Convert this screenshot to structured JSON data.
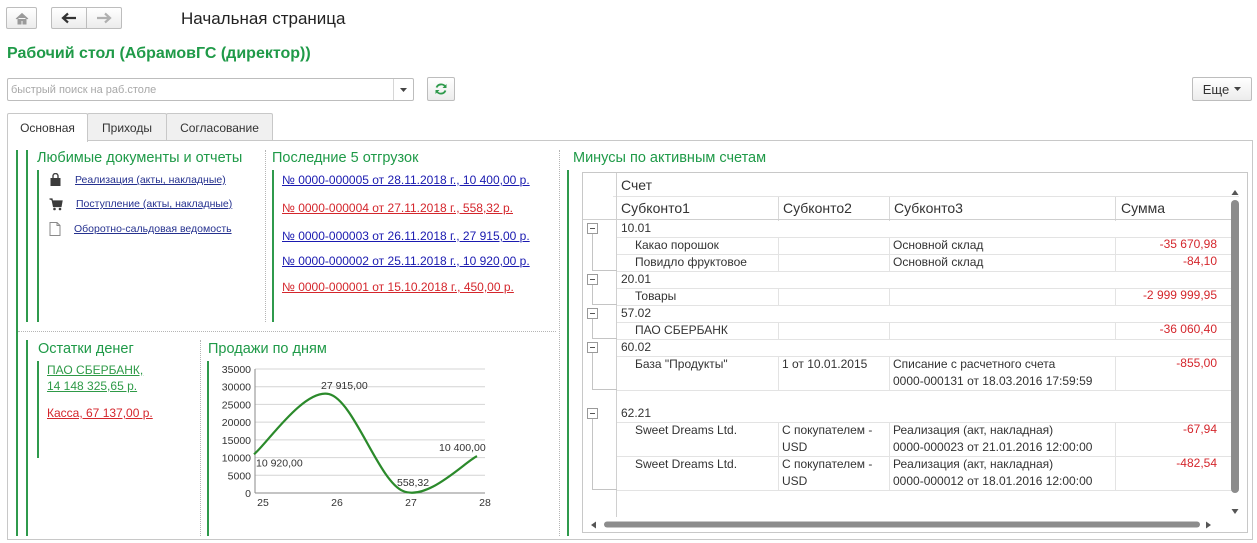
{
  "nav": {
    "title": "Начальная страница",
    "home_icon": "home-icon",
    "back_icon": "arrow-left-icon",
    "forward_icon": "arrow-right-icon"
  },
  "workspace": {
    "title": "Рабочий стол (АбрамовГС (директор))",
    "search_placeholder": "быстрый поиск на раб.столе",
    "more_label": "Еще"
  },
  "tabs": [
    "Основная",
    "Приходы",
    "Согласование"
  ],
  "favorites": {
    "title": "Любимые документы и отчеты",
    "items": [
      {
        "icon": "bag-icon",
        "label": "Реализация (акты, накладные)"
      },
      {
        "icon": "cart-icon",
        "label": "Поступление (акты, накладные)"
      },
      {
        "icon": "document-icon",
        "label": "Оборотно-сальдовая ведомость"
      }
    ]
  },
  "shipments": {
    "title": "Последние 5 отгрузок",
    "items": [
      {
        "label": "№ 0000-000005 от 28.11.2018 г., 10 400,00 р.",
        "color": "#1a1ab0"
      },
      {
        "label": "№ 0000-000004 от 27.11.2018 г., 558,32 р.",
        "color": "#d4262c"
      },
      {
        "label": "№ 0000-000003 от 26.11.2018 г., 27 915,00 р.",
        "color": "#1a1ab0"
      },
      {
        "label": "№ 0000-000002 от 25.11.2018 г., 10 920,00 р.",
        "color": "#1a1ab0"
      },
      {
        "label": "№ 0000-000001 от 15.10.2018 г., 450,00 р.",
        "color": "#d4262c"
      }
    ]
  },
  "money": {
    "title": "Остатки денег",
    "items": [
      {
        "label": "ПАО СБЕРБАНК,",
        "label2": "14 148 325,65 р.",
        "color": "#2e9a47"
      },
      {
        "label": "Касса, 67 137,00 р.",
        "label2": "",
        "color": "#d4262c"
      }
    ]
  },
  "sales": {
    "title": "Продажи по дням"
  },
  "chart_data": {
    "type": "line",
    "categories": [
      "25",
      "26",
      "27",
      "28"
    ],
    "values": [
      10920,
      27915,
      558.32,
      10400
    ],
    "data_labels": [
      "10 920,00",
      "27 915,00",
      "558,32",
      "10 400,00"
    ],
    "y_ticks": [
      "0",
      "5000",
      "10000",
      "15000",
      "20000",
      "25000",
      "30000",
      "35000"
    ],
    "ylim": [
      0,
      35000
    ],
    "color": "#2b8a2b",
    "grid": true
  },
  "minus": {
    "title": "Минусы по активным счетам",
    "headers": {
      "account": "Счет",
      "sub1": "Субконто1",
      "sub2": "Субконто2",
      "sub3": "Субконто3",
      "sum": "Сумма"
    },
    "groups": [
      {
        "account": "10.01",
        "rows": [
          {
            "sub1": "Какао порошок",
            "sub2": "",
            "sub3": "Основной склад",
            "sub3b": "",
            "sub2b": "",
            "sum": "-35 670,98"
          },
          {
            "sub1": "Повидло фруктовое",
            "sub2": "",
            "sub3": "Основной склад",
            "sub3b": "",
            "sub2b": "",
            "sum": "-84,10"
          }
        ]
      },
      {
        "account": "20.01",
        "rows": [
          {
            "sub1": "Товары",
            "sub2": "",
            "sub3": "",
            "sub3b": "",
            "sub2b": "",
            "sum": "-2 999 999,95"
          }
        ]
      },
      {
        "account": "57.02",
        "rows": [
          {
            "sub1": "ПАО СБЕРБАНК",
            "sub2": "",
            "sub3": "",
            "sub3b": "",
            "sub2b": "",
            "sum": "-36 060,40"
          }
        ]
      },
      {
        "account": "60.02",
        "rows": [
          {
            "sub1": "База \"Продукты\"",
            "sub2": "1 от 10.01.2015",
            "sub2b": "",
            "sub3": "Списание с расчетного счета",
            "sub3b": "0000-000131 от 18.03.2016 17:59:59",
            "sum": "-855,00"
          }
        ]
      },
      {
        "account": "62.21",
        "rows": [
          {
            "sub1": "Sweet Dreams Ltd.",
            "sub2": "С покупателем -",
            "sub2b": "USD",
            "sub3": "Реализация (акт, накладная)",
            "sub3b": "0000-000023 от 21.01.2016 12:00:00",
            "sum": "-67,94"
          },
          {
            "sub1": "Sweet Dreams Ltd.",
            "sub2": "С покупателем -",
            "sub2b": "USD",
            "sub3": "Реализация (акт, накладная)",
            "sub3b": "0000-000012 от 18.01.2016 12:00:00",
            "sum": "-482,54"
          }
        ]
      }
    ]
  }
}
